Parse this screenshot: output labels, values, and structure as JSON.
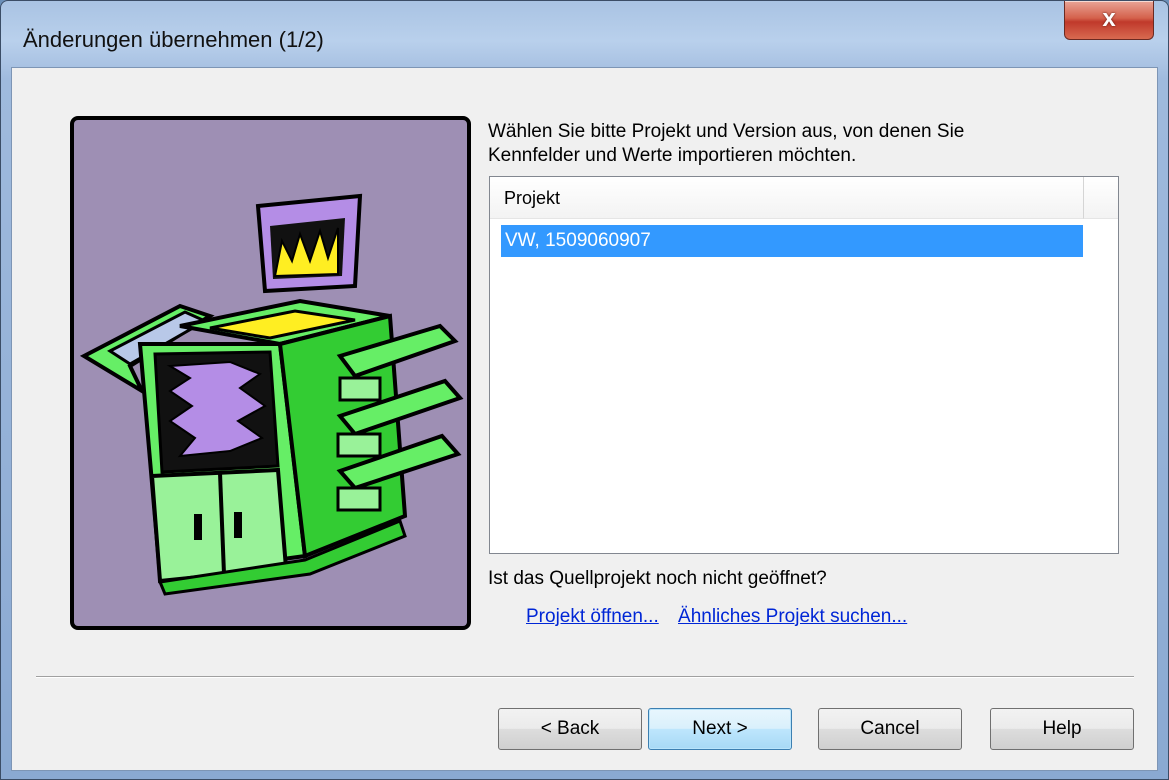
{
  "window": {
    "title": "Änderungen übernehmen (1/2)",
    "close_label": "x"
  },
  "intro_text": "Wählen Sie bitte Projekt und Version aus, von denen Sie Kennfelder und Werte importieren möchten.",
  "project_list": {
    "header": "Projekt",
    "rows": [
      {
        "label": "VW, 1509060907",
        "selected": true
      }
    ]
  },
  "question": "Ist das Quellprojekt noch nicht geöffnet?",
  "links": {
    "open_project": "Projekt öffnen...",
    "find_similar": "Ähnliches Projekt suchen..."
  },
  "buttons": {
    "back": "< Back",
    "next": "Next >",
    "cancel": "Cancel",
    "help": "Help"
  },
  "colors": {
    "selection": "#3399ff",
    "illustration_bg": "#9e8fb4",
    "printer_green": "#66ee66",
    "link": "#0026d6"
  }
}
